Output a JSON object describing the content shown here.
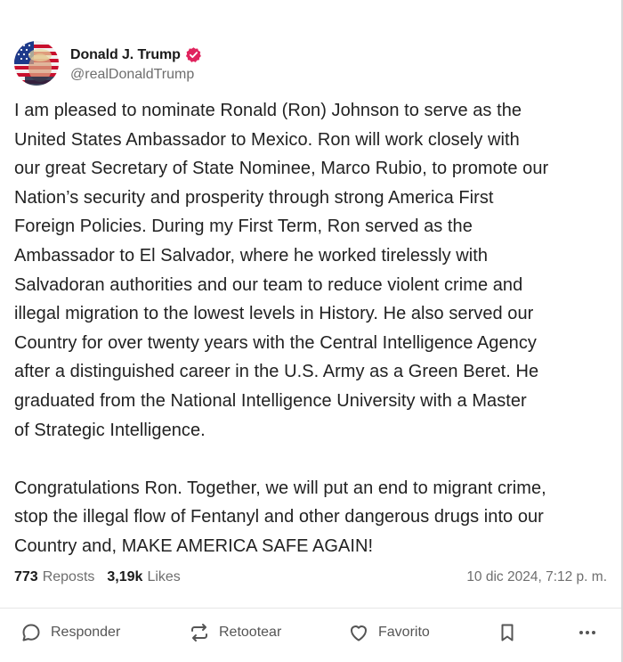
{
  "author": {
    "display_name": "Donald J. Trump",
    "handle": "@realDonaldTrump",
    "verified_color": "#e0245e"
  },
  "post": {
    "paragraph_1": "I am pleased to nominate Ronald (Ron) Johnson to serve as the\nUnited States Ambassador to Mexico. Ron will work closely with\nour great Secretary of State Nominee, Marco Rubio, to promote our\nNation’s security and prosperity through strong America First\nForeign Policies. During my First Term, Ron served as the\nAmbassador to El Salvador, where he worked tirelessly with\nSalvadoran authorities and our team to reduce violent crime and\nillegal migration to the lowest levels in History. He also served our\nCountry for over twenty years with the Central Intelligence Agency\nafter a distinguished career in the U.S. Army as a Green Beret. He\ngraduated from the National Intelligence University with a Master\nof Strategic Intelligence.",
    "paragraph_2": "Congratulations Ron. Together, we will put an end to migrant crime,\nstop the illegal flow of Fentanyl and other dangerous drugs into our\nCountry and, MAKE AMERICA SAFE AGAIN!"
  },
  "stats": {
    "reposts_count": "773",
    "reposts_label": "Reposts",
    "likes_count": "3,19k",
    "likes_label": "Likes",
    "timestamp": "10 dic 2024, 7:12 p. m."
  },
  "actions": {
    "reply": {
      "label": "Responder",
      "icon": "reply-bubble-icon"
    },
    "retruth": {
      "label": "Retootear",
      "icon": "repost-arrows-icon"
    },
    "favorite": {
      "label": "Favorito",
      "icon": "heart-icon"
    },
    "bookmark": {
      "icon": "bookmark-icon"
    },
    "more": {
      "icon": "more-dots-icon"
    }
  },
  "colors": {
    "text": "#222222",
    "muted": "#6e6e6e",
    "icon": "#555555"
  }
}
